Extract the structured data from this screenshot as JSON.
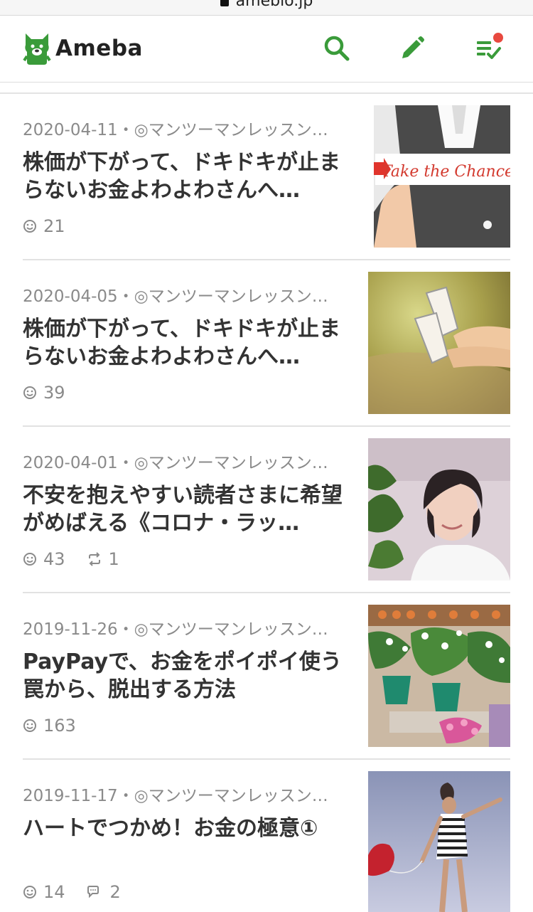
{
  "browser": {
    "url": "ameblo.jp"
  },
  "header": {
    "logo_text": "Ameba",
    "brand_color": "#3a9b3a",
    "icons": [
      "search-icon",
      "pencil-icon",
      "feed-icon"
    ],
    "notification_dot_color": "#e8493f"
  },
  "articles": [
    {
      "meta": "2020-04-11・◎マンツーマンレッスン…",
      "title": "株価が下がって、ドキドキが止まらないお金よわよわさんへ…",
      "likes": "21",
      "thumbnail_text": "Take the Chance"
    },
    {
      "meta": "2020-04-05・◎マンツーマンレッスン…",
      "title": "株価が下がって、ドキドキが止まらないお金よわよわさんへ…",
      "likes": "39"
    },
    {
      "meta": "2020-04-01・◎マンツーマンレッスン…",
      "title": "不安を抱えやすい読者さまに希望がめばえる《コロナ・ラッ…",
      "likes": "43",
      "reblogs": "1"
    },
    {
      "meta": "2019-11-26・◎マンツーマンレッスン…",
      "title": "PayPayで、お金をポイポイ使う罠から、脱出する方法",
      "likes": "163"
    },
    {
      "meta": "2019-11-17・◎マンツーマンレッスン…",
      "title": "ハートでつかめ！お金の極意①",
      "likes": "14",
      "comments": "2"
    }
  ]
}
